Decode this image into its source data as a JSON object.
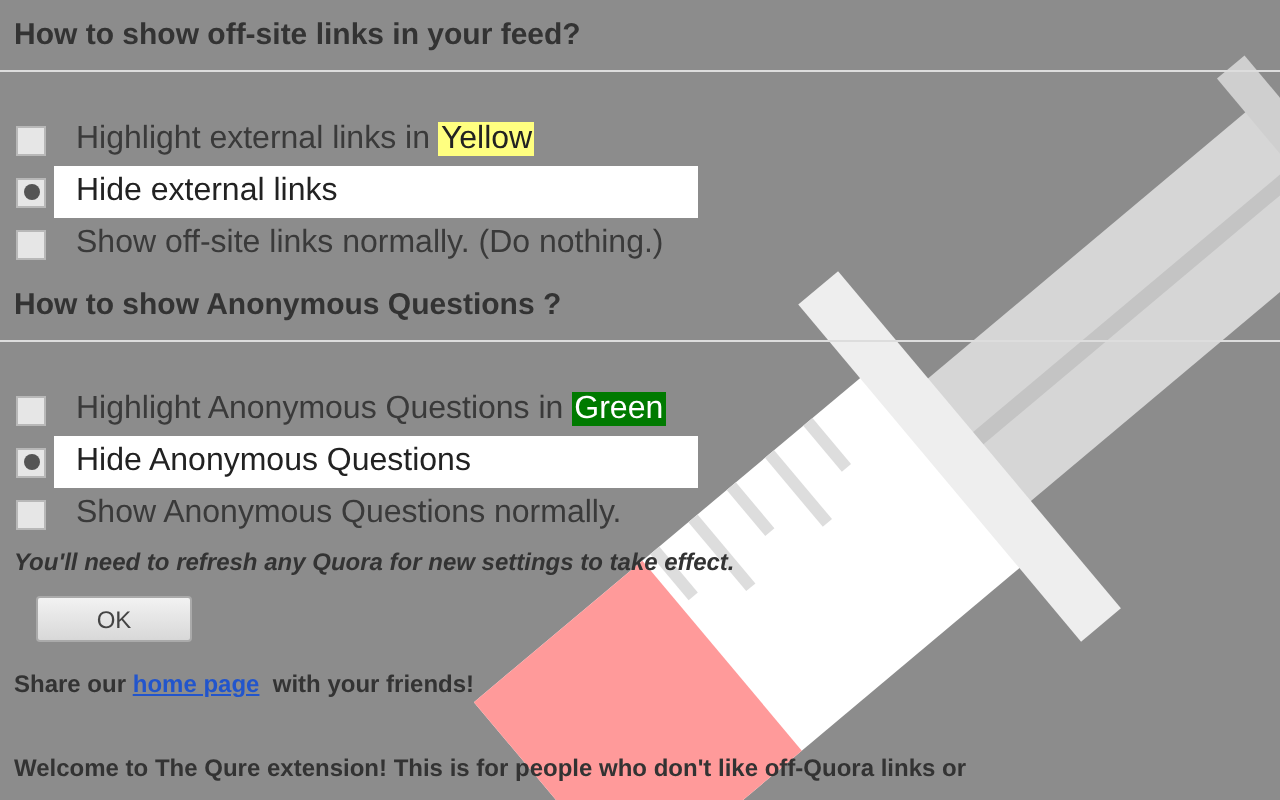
{
  "sections": [
    {
      "heading": "How to show off-site links in your feed?",
      "options": [
        {
          "label": "Highlight external links in",
          "highlight": {
            "text": "Yellow",
            "color": "#ffff80"
          },
          "selected": false
        },
        {
          "label": "Hide external links",
          "selected": true
        },
        {
          "label": "Show off-site links normally. (Do nothing.)",
          "selected": false
        }
      ]
    },
    {
      "heading": "How to show Anonymous Questions ?",
      "options": [
        {
          "label": "Highlight Anonymous Questions in",
          "highlight": {
            "text": "Green",
            "color": "#007a00"
          },
          "selected": false
        },
        {
          "label": "Hide Anonymous Questions",
          "selected": true
        },
        {
          "label": "Show Anonymous Questions normally.",
          "selected": false
        }
      ]
    }
  ],
  "note": "You'll need to refresh any Quora for new settings to take effect.",
  "ok_button": "OK",
  "share": {
    "before": "Share our",
    "link": "home page",
    "after": "with your friends!"
  },
  "welcome": "Welcome to The Qure extension! This is for people who don't like off-Quora links or"
}
